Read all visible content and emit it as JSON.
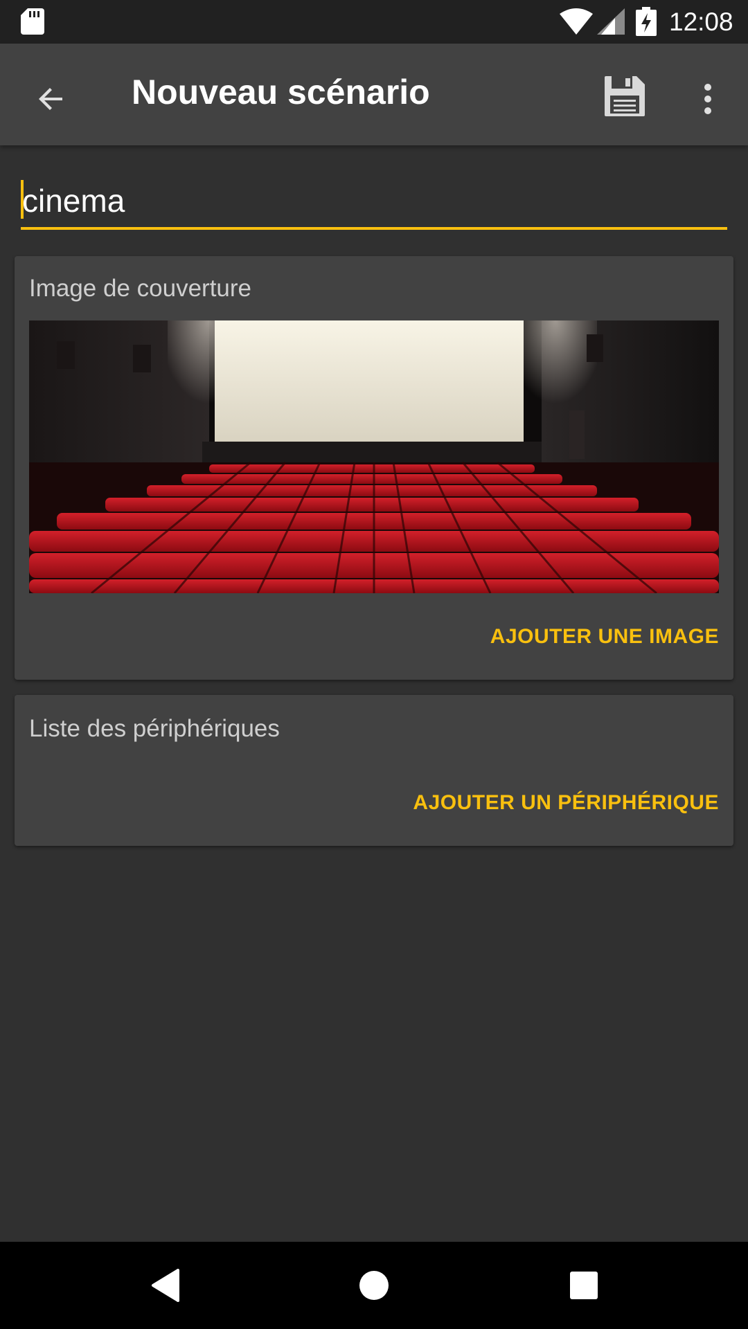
{
  "status_bar": {
    "time": "12:08",
    "icons": [
      "sd-card-icon",
      "wifi-icon",
      "signal-icon",
      "battery-charging-icon"
    ]
  },
  "app_bar": {
    "title": "Nouveau scénario",
    "back_icon": "arrow-back-icon",
    "save_icon": "floppy-save-icon",
    "more_icon": "more-vert-icon"
  },
  "name_field": {
    "value": "cinema"
  },
  "cover_card": {
    "label": "Image de couverture",
    "image_subject": "cinema auditorium with red seats and white screen",
    "action_label": "AJOUTER UNE IMAGE"
  },
  "devices_card": {
    "label": "Liste des périphériques",
    "action_label": "AJOUTER UN PÉRIPHÉRIQUE"
  },
  "nav_bar": {
    "icons": [
      "nav-back-icon",
      "nav-home-icon",
      "nav-recents-icon"
    ]
  },
  "colors": {
    "accent": "#f9c00f",
    "background": "#303030",
    "app_bar": "#424242",
    "card": "#424242",
    "status_bar": "#212121",
    "seat_red": "#c0141a"
  }
}
